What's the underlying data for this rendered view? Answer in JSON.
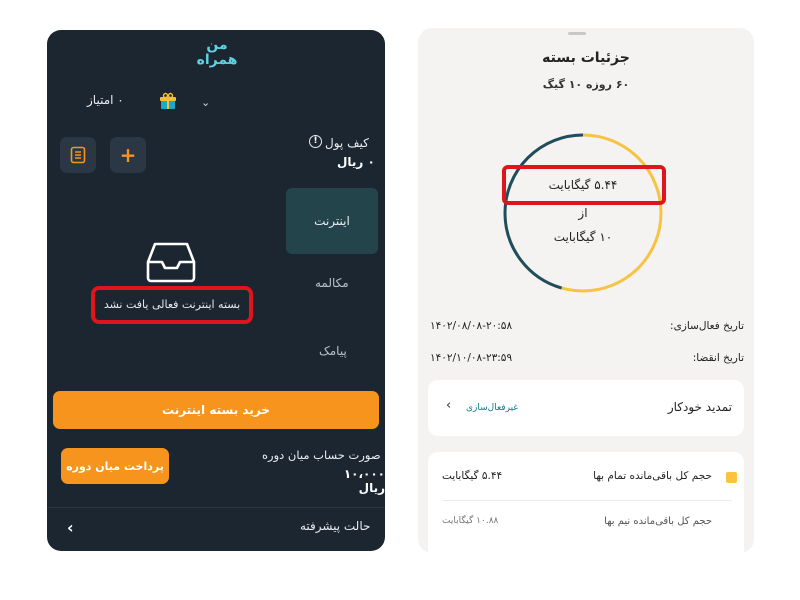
{
  "left_screen": {
    "logo_text": "همراه من",
    "points": "۰ امتیاز",
    "wallet": {
      "title": "کیف پول",
      "value": "۰ ریال"
    },
    "tabs": [
      "اینترنت",
      "مکالمه",
      "پیامک"
    ],
    "empty_message": "بسته اینترنت فعالی یافت نشد",
    "buy_button": "خرید بسته اینترنت",
    "interim_bill": {
      "title": "صورت حساب میان دوره",
      "value": "۱۰،۰۰۰ ریال",
      "pay_button": "پرداخت میان دوره"
    },
    "advanced_mode": "حالت پیشرفته",
    "colors": {
      "bg": "#1b2631",
      "accent": "#f7941d",
      "active_tab": "#24444c",
      "highlight": "#e0141c"
    }
  },
  "right_screen": {
    "title": "جزئیات بسته",
    "subtitle": "۶۰ روزه ۱۰ گیگ",
    "usage": {
      "used": "۵.۴۴ گیگابایت",
      "of": "از",
      "total": "۱۰ گیگابایت",
      "remaining_fraction": 0.544
    },
    "activation": {
      "label": "تاریخ فعال‌سازی:",
      "value": "۱۴۰۲/۰۸/۰۸-۲۰:۵۸"
    },
    "expiry": {
      "label": "تاریخ انقضا:",
      "value": "۱۴۰۲/۱۰/۰۸-۲۳:۵۹"
    },
    "auto_renew": {
      "label": "تمدید خودکار",
      "status": "غیرفعال‌سازی"
    },
    "remaining": {
      "full_label": "حجم کل باقی‌مانده تمام بها",
      "full_value": "۵.۴۴ گیگابایت",
      "half_label": "حجم کل باقی‌مانده نیم بها",
      "half_value": "۱۰.۸۸ گیگابایت"
    },
    "colors": {
      "ring_remaining": "#f6c343",
      "ring_used": "#1d4e5f",
      "highlight": "#e0141c"
    }
  }
}
